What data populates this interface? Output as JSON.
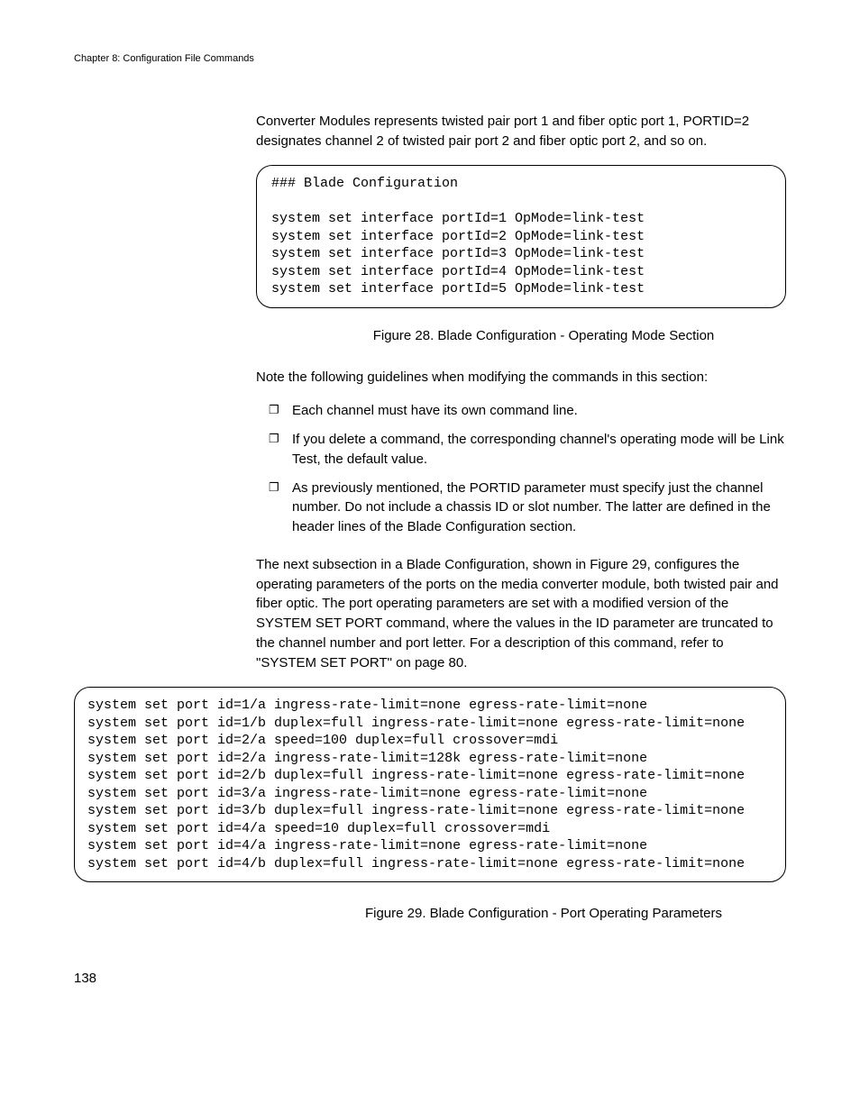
{
  "header": "Chapter 8: Configuration File Commands",
  "intro_paragraph": "Converter Modules represents twisted pair port 1 and fiber optic port 1, PORTID=2 designates channel 2 of twisted pair port 2 and fiber optic port 2, and so on.",
  "codebox1": "### Blade Configuration\n\nsystem set interface portId=1 OpMode=link-test\nsystem set interface portId=2 OpMode=link-test\nsystem set interface portId=3 OpMode=link-test\nsystem set interface portId=4 OpMode=link-test\nsystem set interface portId=5 OpMode=link-test",
  "figure28_caption": "Figure 28. Blade Configuration - Operating Mode Section",
  "note_intro": "Note the following guidelines when modifying the commands in this section:",
  "bullets": [
    "Each channel must have its own command line.",
    "If you delete a command, the corresponding channel's operating mode will be Link Test, the default value.",
    "As previously mentioned, the PORTID parameter must specify just the channel number. Do not include a chassis ID or slot number. The latter are defined in the header lines of the Blade Configuration section."
  ],
  "next_paragraph": "The next subsection in a Blade Configuration, shown in Figure 29, configures the operating parameters of the ports on the media converter module, both twisted pair and fiber optic. The port operating parameters are set with a modified version of the SYSTEM SET PORT command, where the values in the ID parameter are truncated to the channel number and port letter. For a description of this command, refer to \"SYSTEM SET PORT\" on page 80.",
  "codebox2": "system set port id=1/a ingress-rate-limit=none egress-rate-limit=none\nsystem set port id=1/b duplex=full ingress-rate-limit=none egress-rate-limit=none\nsystem set port id=2/a speed=100 duplex=full crossover=mdi\nsystem set port id=2/a ingress-rate-limit=128k egress-rate-limit=none\nsystem set port id=2/b duplex=full ingress-rate-limit=none egress-rate-limit=none\nsystem set port id=3/a ingress-rate-limit=none egress-rate-limit=none\nsystem set port id=3/b duplex=full ingress-rate-limit=none egress-rate-limit=none\nsystem set port id=4/a speed=10 duplex=full crossover=mdi\nsystem set port id=4/a ingress-rate-limit=none egress-rate-limit=none\nsystem set port id=4/b duplex=full ingress-rate-limit=none egress-rate-limit=none",
  "figure29_caption": "Figure 29. Blade Configuration - Port Operating Parameters",
  "page_number": "138"
}
